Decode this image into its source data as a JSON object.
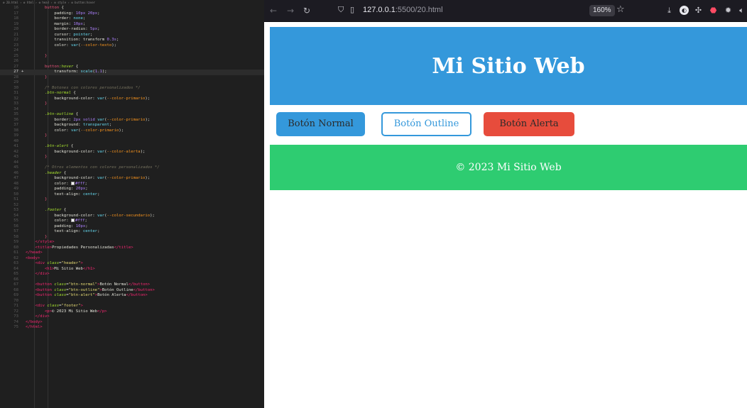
{
  "editor": {
    "breadcrumb": "⚙ 20.html › ⚙ html › ⚙ head › ⚙ style › ⚙ button:hover",
    "active_line": "27",
    "lines": [
      {
        "n": "16",
        "tokens": [
          {
            "t": "        ",
            "c": "def"
          },
          {
            "t": "button",
            "c": "sel"
          },
          {
            "t": " {",
            "c": "def"
          }
        ]
      },
      {
        "n": "17",
        "tokens": [
          {
            "t": "            padding",
            "c": "prop"
          },
          {
            "t": ": ",
            "c": "def"
          },
          {
            "t": "10px 20px",
            "c": "num"
          },
          {
            "t": ";",
            "c": "def"
          }
        ]
      },
      {
        "n": "18",
        "tokens": [
          {
            "t": "            border",
            "c": "prop"
          },
          {
            "t": ": ",
            "c": "def"
          },
          {
            "t": "none",
            "c": "val"
          },
          {
            "t": ";",
            "c": "def"
          }
        ]
      },
      {
        "n": "19",
        "tokens": [
          {
            "t": "            margin",
            "c": "prop"
          },
          {
            "t": ": ",
            "c": "def"
          },
          {
            "t": "10px",
            "c": "num"
          },
          {
            "t": ";",
            "c": "def"
          }
        ]
      },
      {
        "n": "20",
        "tokens": [
          {
            "t": "            border-radius",
            "c": "prop"
          },
          {
            "t": ": ",
            "c": "def"
          },
          {
            "t": "5px",
            "c": "num"
          },
          {
            "t": ";",
            "c": "def"
          }
        ]
      },
      {
        "n": "21",
        "tokens": [
          {
            "t": "            cursor",
            "c": "prop"
          },
          {
            "t": ": ",
            "c": "def"
          },
          {
            "t": "pointer",
            "c": "val"
          },
          {
            "t": ";",
            "c": "def"
          }
        ]
      },
      {
        "n": "22",
        "tokens": [
          {
            "t": "            transition",
            "c": "prop"
          },
          {
            "t": ": transform ",
            "c": "def"
          },
          {
            "t": "0.3s",
            "c": "num"
          },
          {
            "t": ";",
            "c": "def"
          }
        ]
      },
      {
        "n": "23",
        "tokens": [
          {
            "t": "            color",
            "c": "prop"
          },
          {
            "t": ": ",
            "c": "def"
          },
          {
            "t": "var",
            "c": "val"
          },
          {
            "t": "(",
            "c": "def"
          },
          {
            "t": "--color-texto",
            "c": "var"
          },
          {
            "t": ");",
            "c": "def"
          }
        ]
      },
      {
        "n": "24",
        "tokens": [
          {
            "t": "        ",
            "c": "def"
          }
        ]
      },
      {
        "n": "25",
        "tokens": [
          {
            "t": "        }",
            "c": "sel"
          }
        ]
      },
      {
        "n": "26",
        "tokens": [
          {
            "t": "",
            "c": "def"
          }
        ]
      },
      {
        "n": "27",
        "tokens": [
          {
            "t": "        ",
            "c": "def"
          },
          {
            "t": "button",
            "c": "sel"
          },
          {
            "t": ":hover",
            "c": "cls"
          },
          {
            "t": " {",
            "c": "def"
          }
        ]
      },
      {
        "n": "27",
        "tokens": [
          {
            "t": "            transform",
            "c": "prop"
          },
          {
            "t": ": ",
            "c": "def"
          },
          {
            "t": "scale",
            "c": "val"
          },
          {
            "t": "(",
            "c": "def"
          },
          {
            "t": "1.1",
            "c": "num"
          },
          {
            "t": ");",
            "c": "def"
          }
        ]
      },
      {
        "n": "28",
        "tokens": [
          {
            "t": "        }",
            "c": "sel"
          }
        ]
      },
      {
        "n": "29",
        "tokens": [
          {
            "t": "",
            "c": "def"
          }
        ]
      },
      {
        "n": "30",
        "tokens": [
          {
            "t": "        /* Botones con colores personalizados */",
            "c": "com"
          }
        ]
      },
      {
        "n": "31",
        "tokens": [
          {
            "t": "        ",
            "c": "def"
          },
          {
            "t": ".btn-normal",
            "c": "cls"
          },
          {
            "t": " {",
            "c": "def"
          }
        ]
      },
      {
        "n": "32",
        "tokens": [
          {
            "t": "            background-color",
            "c": "prop"
          },
          {
            "t": ": ",
            "c": "def"
          },
          {
            "t": "var",
            "c": "val"
          },
          {
            "t": "(",
            "c": "def"
          },
          {
            "t": "--color-primario",
            "c": "var"
          },
          {
            "t": ");",
            "c": "def"
          }
        ]
      },
      {
        "n": "33",
        "tokens": [
          {
            "t": "        }",
            "c": "sel"
          }
        ]
      },
      {
        "n": "34",
        "tokens": [
          {
            "t": "",
            "c": "def"
          }
        ]
      },
      {
        "n": "35",
        "tokens": [
          {
            "t": "        ",
            "c": "def"
          },
          {
            "t": ".btn-outline",
            "c": "cls"
          },
          {
            "t": " {",
            "c": "def"
          }
        ]
      },
      {
        "n": "36",
        "tokens": [
          {
            "t": "            border",
            "c": "prop"
          },
          {
            "t": ": ",
            "c": "def"
          },
          {
            "t": "2px solid ",
            "c": "num"
          },
          {
            "t": "var",
            "c": "val"
          },
          {
            "t": "(",
            "c": "def"
          },
          {
            "t": "--color-primario",
            "c": "var"
          },
          {
            "t": ");",
            "c": "def"
          }
        ]
      },
      {
        "n": "37",
        "tokens": [
          {
            "t": "            background",
            "c": "prop"
          },
          {
            "t": ": ",
            "c": "def"
          },
          {
            "t": "transparent",
            "c": "val"
          },
          {
            "t": ";",
            "c": "def"
          }
        ]
      },
      {
        "n": "38",
        "tokens": [
          {
            "t": "            color",
            "c": "prop"
          },
          {
            "t": ": ",
            "c": "def"
          },
          {
            "t": "var",
            "c": "val"
          },
          {
            "t": "(",
            "c": "def"
          },
          {
            "t": "--color-primario",
            "c": "var"
          },
          {
            "t": ");",
            "c": "def"
          }
        ]
      },
      {
        "n": "39",
        "tokens": [
          {
            "t": "        }",
            "c": "sel"
          }
        ]
      },
      {
        "n": "40",
        "tokens": [
          {
            "t": "",
            "c": "def"
          }
        ]
      },
      {
        "n": "41",
        "tokens": [
          {
            "t": "        ",
            "c": "def"
          },
          {
            "t": ".btn-alert",
            "c": "cls"
          },
          {
            "t": " {",
            "c": "def"
          }
        ]
      },
      {
        "n": "42",
        "tokens": [
          {
            "t": "            background-color",
            "c": "prop"
          },
          {
            "t": ": ",
            "c": "def"
          },
          {
            "t": "var",
            "c": "val"
          },
          {
            "t": "(",
            "c": "def"
          },
          {
            "t": "--color-alerta",
            "c": "var"
          },
          {
            "t": ");",
            "c": "def"
          }
        ]
      },
      {
        "n": "43",
        "tokens": [
          {
            "t": "        }",
            "c": "sel"
          }
        ]
      },
      {
        "n": "44",
        "tokens": [
          {
            "t": "",
            "c": "def"
          }
        ]
      },
      {
        "n": "45",
        "tokens": [
          {
            "t": "        /* Otros elementos con colores personalizados */",
            "c": "com"
          }
        ]
      },
      {
        "n": "46",
        "tokens": [
          {
            "t": "        ",
            "c": "def"
          },
          {
            "t": ".header",
            "c": "cls"
          },
          {
            "t": " {",
            "c": "def"
          }
        ]
      },
      {
        "n": "47",
        "tokens": [
          {
            "t": "            background-color",
            "c": "prop"
          },
          {
            "t": ": ",
            "c": "def"
          },
          {
            "t": "var",
            "c": "val"
          },
          {
            "t": "(",
            "c": "def"
          },
          {
            "t": "--color-primario",
            "c": "var"
          },
          {
            "t": ");",
            "c": "def"
          }
        ]
      },
      {
        "n": "48",
        "tokens": [
          {
            "t": "            color",
            "c": "prop"
          },
          {
            "t": ": ",
            "c": "def"
          },
          {
            "t": "■",
            "c": "swatch"
          },
          {
            "t": "#fff",
            "c": "num"
          },
          {
            "t": ";",
            "c": "def"
          }
        ]
      },
      {
        "n": "49",
        "tokens": [
          {
            "t": "            padding",
            "c": "prop"
          },
          {
            "t": ": ",
            "c": "def"
          },
          {
            "t": "20px",
            "c": "num"
          },
          {
            "t": ";",
            "c": "def"
          }
        ]
      },
      {
        "n": "50",
        "tokens": [
          {
            "t": "            text-align",
            "c": "prop"
          },
          {
            "t": ": ",
            "c": "def"
          },
          {
            "t": "center",
            "c": "val"
          },
          {
            "t": ";",
            "c": "def"
          }
        ]
      },
      {
        "n": "51",
        "tokens": [
          {
            "t": "        }",
            "c": "sel"
          }
        ]
      },
      {
        "n": "52",
        "tokens": [
          {
            "t": "",
            "c": "def"
          }
        ]
      },
      {
        "n": "53",
        "tokens": [
          {
            "t": "        ",
            "c": "def"
          },
          {
            "t": ".footer",
            "c": "cls"
          },
          {
            "t": " {",
            "c": "def"
          }
        ]
      },
      {
        "n": "54",
        "tokens": [
          {
            "t": "            background-color",
            "c": "prop"
          },
          {
            "t": ": ",
            "c": "def"
          },
          {
            "t": "var",
            "c": "val"
          },
          {
            "t": "(",
            "c": "def"
          },
          {
            "t": "--color-secundario",
            "c": "var"
          },
          {
            "t": ");",
            "c": "def"
          }
        ]
      },
      {
        "n": "55",
        "tokens": [
          {
            "t": "            color",
            "c": "prop"
          },
          {
            "t": ": ",
            "c": "def"
          },
          {
            "t": "■",
            "c": "swatch"
          },
          {
            "t": "#fff",
            "c": "num"
          },
          {
            "t": ";",
            "c": "def"
          }
        ]
      },
      {
        "n": "56",
        "tokens": [
          {
            "t": "            padding",
            "c": "prop"
          },
          {
            "t": ": ",
            "c": "def"
          },
          {
            "t": "10px",
            "c": "num"
          },
          {
            "t": ";",
            "c": "def"
          }
        ]
      },
      {
        "n": "57",
        "tokens": [
          {
            "t": "            text-align",
            "c": "prop"
          },
          {
            "t": ": ",
            "c": "def"
          },
          {
            "t": "center",
            "c": "val"
          },
          {
            "t": ";",
            "c": "def"
          }
        ]
      },
      {
        "n": "58",
        "tokens": [
          {
            "t": "        }",
            "c": "sel"
          }
        ]
      },
      {
        "n": "59",
        "tokens": [
          {
            "t": "    </",
            "c": "tag"
          },
          {
            "t": "style",
            "c": "tag"
          },
          {
            "t": ">",
            "c": "tag"
          }
        ]
      },
      {
        "n": "60",
        "tokens": [
          {
            "t": "    <",
            "c": "tag"
          },
          {
            "t": "title",
            "c": "tag"
          },
          {
            "t": ">",
            "c": "tag"
          },
          {
            "t": "Propiedades Personalizadas",
            "c": "def"
          },
          {
            "t": "</title>",
            "c": "tag"
          }
        ]
      },
      {
        "n": "61",
        "tokens": [
          {
            "t": "</head>",
            "c": "tag"
          }
        ]
      },
      {
        "n": "62",
        "tokens": [
          {
            "t": "<body>",
            "c": "tag"
          }
        ]
      },
      {
        "n": "63",
        "tokens": [
          {
            "t": "    <div ",
            "c": "tag"
          },
          {
            "t": "class",
            "c": "attr"
          },
          {
            "t": "=",
            "c": "def"
          },
          {
            "t": "\"header\"",
            "c": "str"
          },
          {
            "t": ">",
            "c": "tag"
          }
        ]
      },
      {
        "n": "64",
        "tokens": [
          {
            "t": "        <h1>",
            "c": "tag"
          },
          {
            "t": "Mi Sitio Web",
            "c": "def"
          },
          {
            "t": "</h1>",
            "c": "tag"
          }
        ]
      },
      {
        "n": "65",
        "tokens": [
          {
            "t": "    </div>",
            "c": "tag"
          }
        ]
      },
      {
        "n": "66",
        "tokens": [
          {
            "t": "",
            "c": "def"
          }
        ]
      },
      {
        "n": "67",
        "tokens": [
          {
            "t": "    <button ",
            "c": "tag"
          },
          {
            "t": "class",
            "c": "attr"
          },
          {
            "t": "=",
            "c": "def"
          },
          {
            "t": "\"btn-normal\"",
            "c": "str"
          },
          {
            "t": ">",
            "c": "tag"
          },
          {
            "t": "Botón Normal",
            "c": "def"
          },
          {
            "t": "</button>",
            "c": "tag"
          }
        ]
      },
      {
        "n": "68",
        "tokens": [
          {
            "t": "    <button ",
            "c": "tag"
          },
          {
            "t": "class",
            "c": "attr"
          },
          {
            "t": "=",
            "c": "def"
          },
          {
            "t": "\"btn-outline\"",
            "c": "str"
          },
          {
            "t": ">",
            "c": "tag"
          },
          {
            "t": "Botón Outline",
            "c": "def"
          },
          {
            "t": "</button>",
            "c": "tag"
          }
        ]
      },
      {
        "n": "69",
        "tokens": [
          {
            "t": "    <button ",
            "c": "tag"
          },
          {
            "t": "class",
            "c": "attr"
          },
          {
            "t": "=",
            "c": "def"
          },
          {
            "t": "\"btn-alert\"",
            "c": "str"
          },
          {
            "t": ">",
            "c": "tag"
          },
          {
            "t": "Botón Alerta",
            "c": "def"
          },
          {
            "t": "</button>",
            "c": "tag"
          }
        ]
      },
      {
        "n": "70",
        "tokens": [
          {
            "t": "",
            "c": "def"
          }
        ]
      },
      {
        "n": "71",
        "tokens": [
          {
            "t": "    <div ",
            "c": "tag"
          },
          {
            "t": "class",
            "c": "attr"
          },
          {
            "t": "=",
            "c": "def"
          },
          {
            "t": "\"footer\"",
            "c": "str"
          },
          {
            "t": ">",
            "c": "tag"
          }
        ]
      },
      {
        "n": "72",
        "tokens": [
          {
            "t": "        <p>",
            "c": "tag"
          },
          {
            "t": "© 2023 Mi Sitio Web",
            "c": "def"
          },
          {
            "t": "</p>",
            "c": "tag"
          }
        ]
      },
      {
        "n": "73",
        "tokens": [
          {
            "t": "    </div>",
            "c": "tag"
          }
        ]
      },
      {
        "n": "74",
        "tokens": [
          {
            "t": "</body>",
            "c": "tag"
          }
        ]
      },
      {
        "n": "75",
        "tokens": [
          {
            "t": "</html>",
            "c": "tag"
          }
        ]
      }
    ]
  },
  "browser": {
    "back_icon": "←",
    "forward_icon": "→",
    "reload_icon": "↻",
    "url_host": "127.0.0.1",
    "url_path": ":5500/20.html",
    "zoom": "160%",
    "icons": {
      "shield": "shield-icon",
      "page": "page-icon",
      "star": "star-icon",
      "download": "download-icon",
      "puzzle": "puzzle-icon",
      "gear": "gear-icon",
      "volume": "volume-icon"
    }
  },
  "page": {
    "header_title": "Mi Sitio Web",
    "buttons": {
      "normal": "Botón Normal",
      "outline": "Botón Outline",
      "alert": "Botón Alerta"
    },
    "footer_text": "© 2023 Mi Sitio Web",
    "colors": {
      "primario": "#3498db",
      "secundario": "#2ecc71",
      "alerta": "#e74c3c",
      "texto": "#2b2b2b"
    }
  }
}
